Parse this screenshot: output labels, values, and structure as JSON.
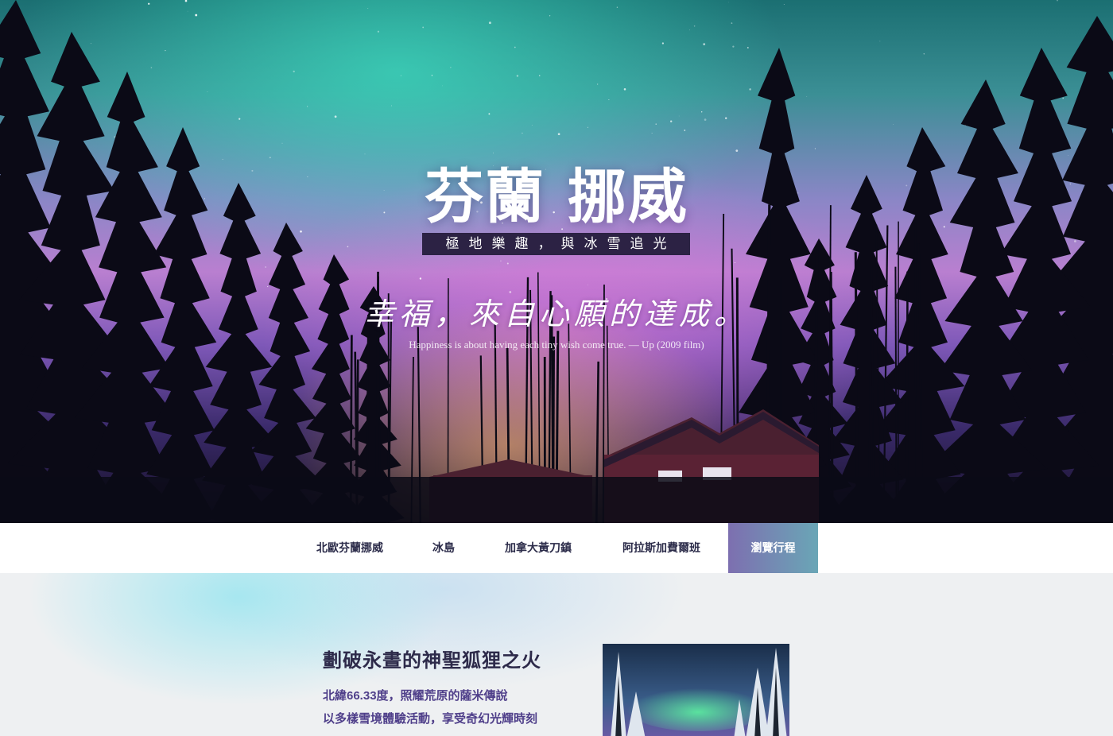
{
  "hero": {
    "title": "芬蘭 挪威",
    "subtitle": "極地樂趣，與冰雪追光",
    "handwriting": "幸福，來自心願的達成。",
    "quote": "Happiness is about having each tiny wish come true. — Up (2009 film)"
  },
  "nav": {
    "items": [
      {
        "label": "北歐芬蘭挪威"
      },
      {
        "label": "冰島"
      },
      {
        "label": "加拿大黃刀鎮"
      },
      {
        "label": "阿拉斯加費爾班"
      }
    ],
    "cta_label": "瀏覽行程"
  },
  "section": {
    "title": "劃破永晝的神聖狐狸之火",
    "lines": [
      "北緯66.33度，照耀荒原的薩米傳說",
      "以多樣雪境體驗活動，享受奇幻光輝時刻"
    ]
  },
  "colors": {
    "nav_text": "#2c2c4a",
    "cta_start": "#7d6fb0",
    "cta_end": "#6aa6b6",
    "section_text": "#4f3f8a",
    "subtitle_bg": "#2c2244"
  }
}
